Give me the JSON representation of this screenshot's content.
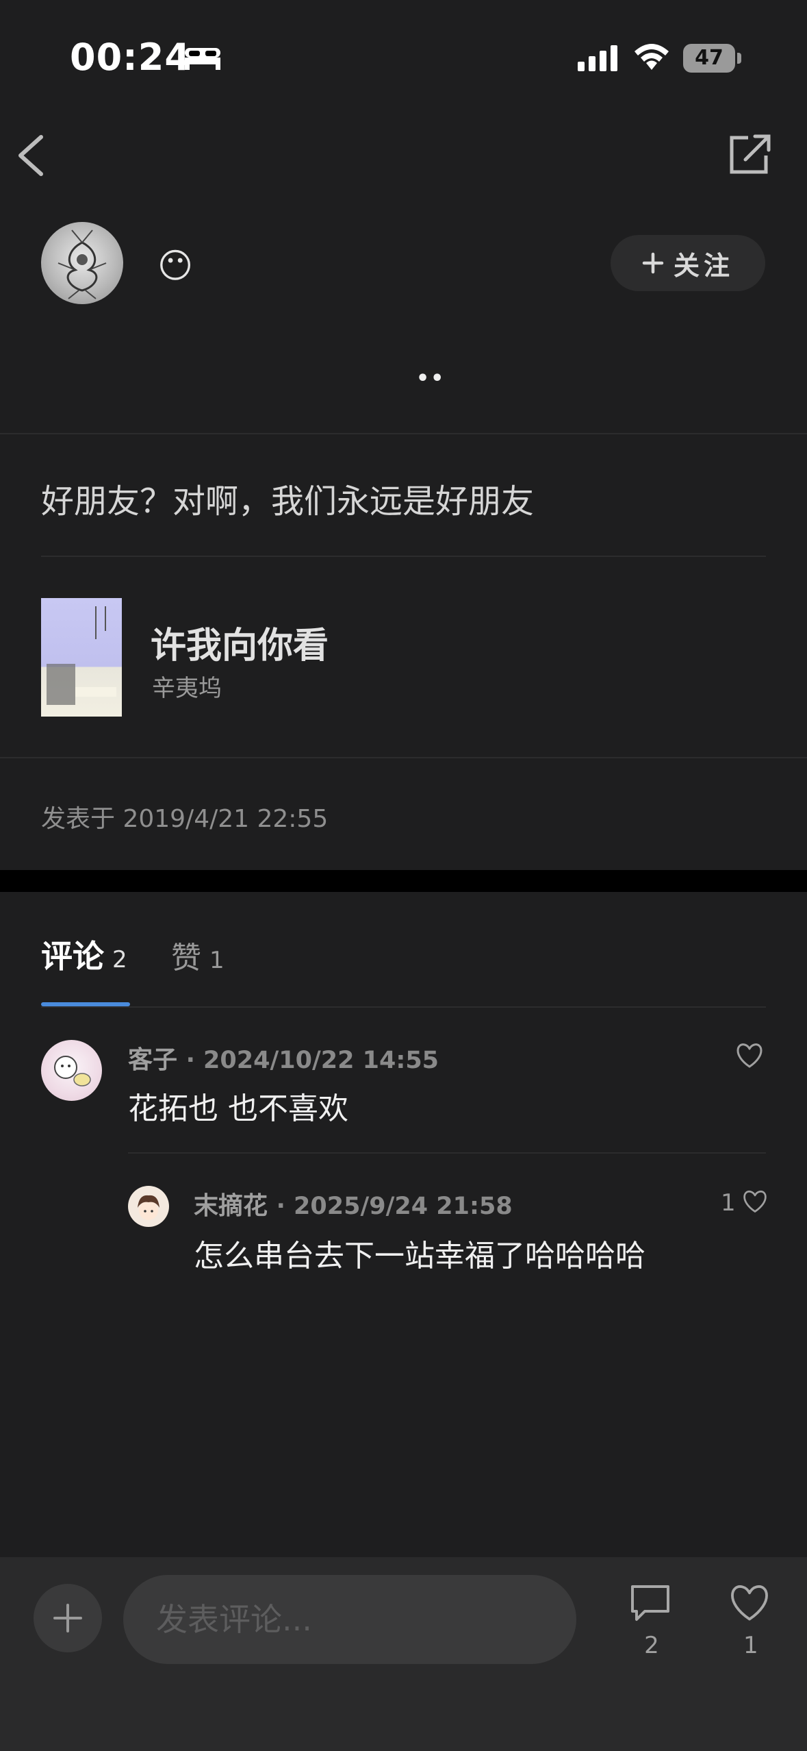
{
  "status_bar": {
    "time": "00:24",
    "battery": "47"
  },
  "author": {
    "emoji": "😶",
    "follow_label": "关注",
    "dots": "••"
  },
  "post": {
    "text": "好朋友？对啊，我们永远是好朋友",
    "book": {
      "title": "许我向你看",
      "author": "辛夷坞"
    },
    "posted_at": "发表于 2019/4/21 22:55"
  },
  "tabs": {
    "comments_label": "评论",
    "comments_count": "2",
    "likes_label": "赞",
    "likes_count": "1"
  },
  "comments": [
    {
      "user": "客子",
      "time": "· 2024/10/22 14:55",
      "text": "花拓也 也不喜欢"
    },
    {
      "user": "末摘花",
      "time": "· 2025/9/24 21:58",
      "text": "怎么串台去下一站幸福了哈哈哈哈",
      "likes": "1"
    }
  ],
  "bottom_bar": {
    "input_placeholder": "发表评论...",
    "comment_count": "2",
    "like_count": "1"
  },
  "colors": {
    "background": "#1e1e1f",
    "accent": "#4a8bdc",
    "bottom_bar": "#2a2a2b"
  }
}
